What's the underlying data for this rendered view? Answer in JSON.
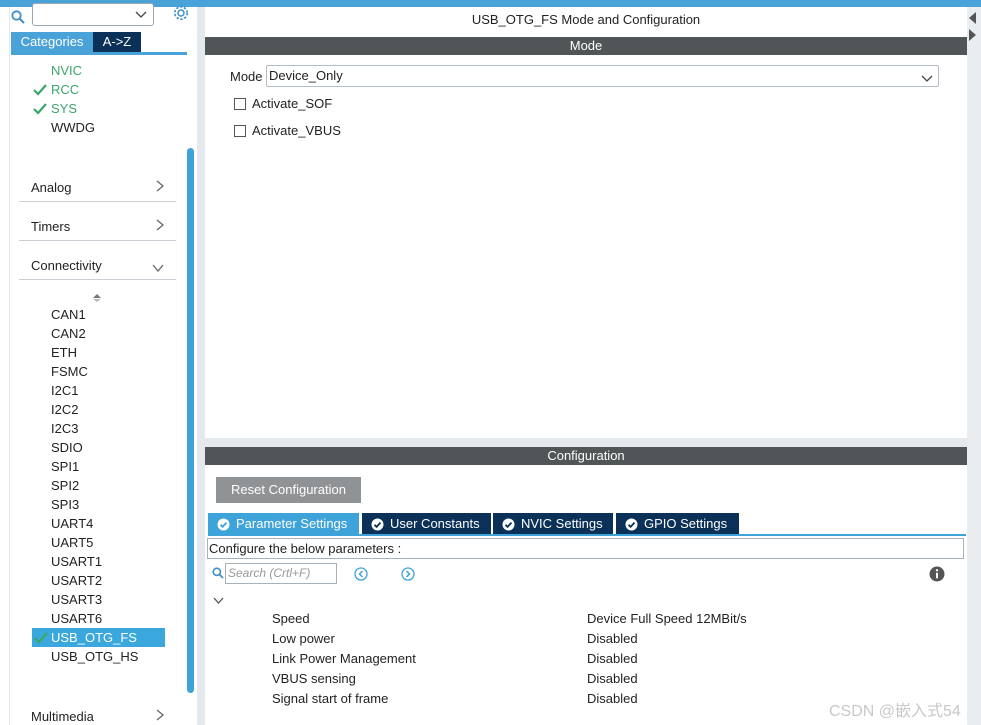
{
  "sidebar": {
    "search_value": "",
    "tabs": [
      "Categories",
      "A->Z"
    ],
    "system_items": [
      {
        "label": "NVIC",
        "enabled": true,
        "checked": false
      },
      {
        "label": "RCC",
        "enabled": true,
        "checked": true
      },
      {
        "label": "SYS",
        "enabled": true,
        "checked": true
      },
      {
        "label": "WWDG",
        "enabled": false,
        "checked": false
      }
    ],
    "groups": {
      "analog": "Analog",
      "timers": "Timers",
      "connectivity": "Connectivity",
      "multimedia": "Multimedia"
    },
    "connectivity_items": [
      "CAN1",
      "CAN2",
      "ETH",
      "FSMC",
      "I2C1",
      "I2C2",
      "I2C3",
      "SDIO",
      "SPI1",
      "SPI2",
      "SPI3",
      "UART4",
      "UART5",
      "USART1",
      "USART2",
      "USART3",
      "USART6",
      "USB_OTG_FS",
      "USB_OTG_HS"
    ],
    "selected_item": "USB_OTG_FS"
  },
  "mode_panel": {
    "title": "USB_OTG_FS Mode and Configuration",
    "section": "Mode",
    "mode_label": "Mode",
    "mode_value": "Device_Only",
    "checkboxes": [
      {
        "label": "Activate_SOF",
        "checked": false
      },
      {
        "label": "Activate_VBUS",
        "checked": false
      }
    ]
  },
  "config_panel": {
    "section": "Configuration",
    "reset_label": "Reset Configuration",
    "tabs": [
      "Parameter Settings",
      "User Constants",
      "NVIC Settings",
      "GPIO Settings"
    ],
    "active_tab": "Parameter Settings",
    "hint": "Configure the below parameters :",
    "search_placeholder": "Search (Crtl+F)",
    "parameters": [
      {
        "name": "Speed",
        "value": "Device Full Speed 12MBit/s"
      },
      {
        "name": "Low power",
        "value": "Disabled"
      },
      {
        "name": "Link Power Management",
        "value": "Disabled"
      },
      {
        "name": "VBUS sensing",
        "value": "Disabled"
      },
      {
        "name": "Signal start of frame",
        "value": "Disabled"
      }
    ]
  },
  "watermark": "CSDN @嵌入式54",
  "colors": {
    "accent": "#3ea3d8",
    "dark_tab": "#0b3158",
    "section_bar": "#505558",
    "enabled_green": "#3aa66a"
  }
}
